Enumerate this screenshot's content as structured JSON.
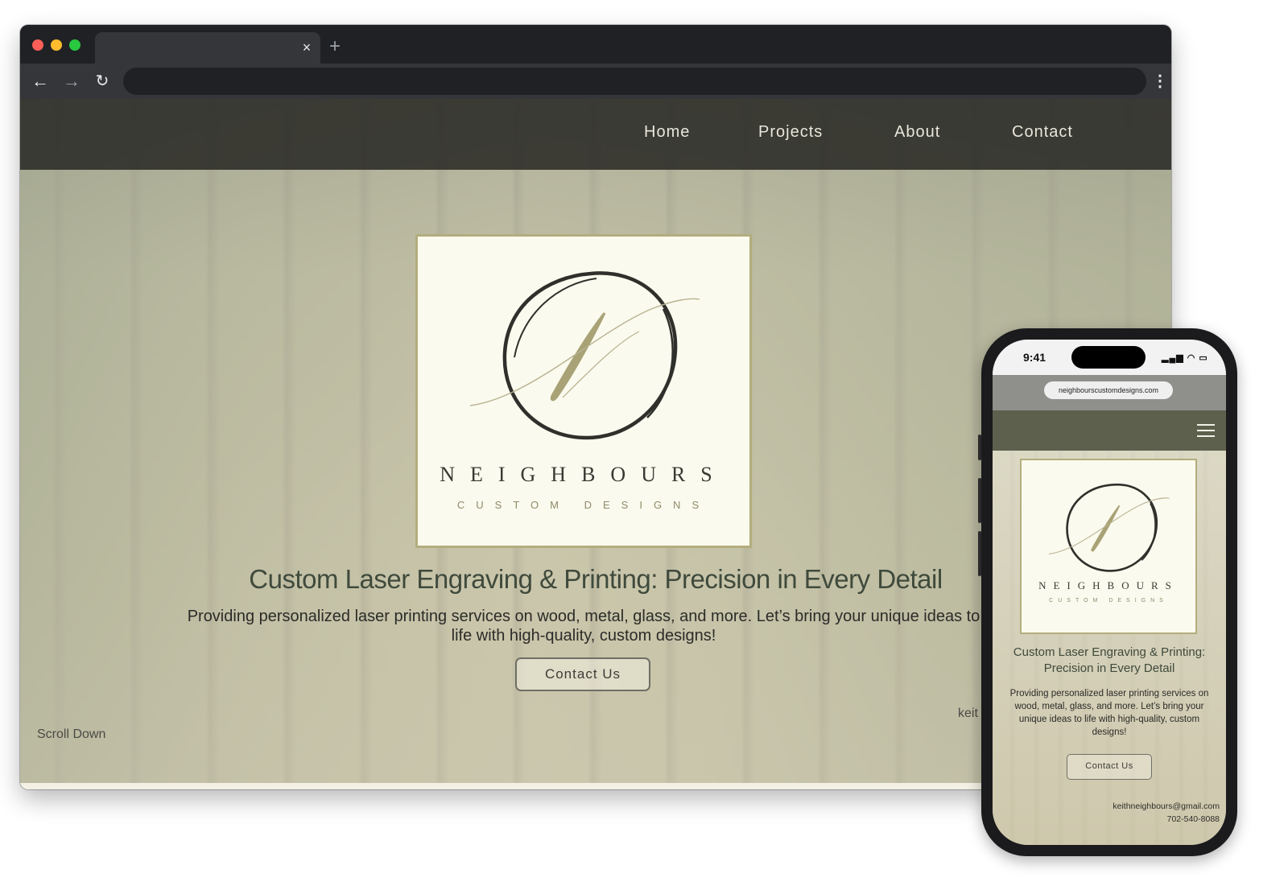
{
  "browser": {
    "tab_close": "×",
    "new_tab": "+",
    "back": "←",
    "forward": "→",
    "reload": "↻",
    "menu": "⋮"
  },
  "site": {
    "nav": [
      "Home",
      "Projects",
      "About",
      "Contact"
    ],
    "brand_name": "NEIGHBOURS",
    "brand_sub": "CUSTOM DESIGNS",
    "hero_title": "Custom Laser Engraving & Printing: Precision in Every Detail",
    "hero_text": "Providing personalized laser printing services on wood, metal, glass, and more. Let’s bring your unique ideas to life with high-quality, custom designs!",
    "cta": "Contact Us",
    "scroll_down": "Scroll Down",
    "email_partial": "keit"
  },
  "phone": {
    "time": "9:41",
    "signal": "▂▄▆ ◠ ▭",
    "url": "neighbourscustomdesigns.com",
    "brand_name": "NEIGHBOURS",
    "brand_sub": "CUSTOM DESIGNS",
    "hero_title": "Custom Laser Engraving & Printing: Precision in Every Detail",
    "hero_text": "Providing personalized laser printing services on wood, metal, glass, and more. Let’s bring your unique ideas to life with high-quality, custom designs!",
    "cta": "Contact Us",
    "email": "keithneighbours@gmail.com",
    "phone_number": "702-540-8088"
  },
  "colors": {
    "nav_bg": "#282824",
    "card_bg": "#fbfaee",
    "accent_olive": "#b3ad7e",
    "title_green": "#3f4a3c"
  }
}
